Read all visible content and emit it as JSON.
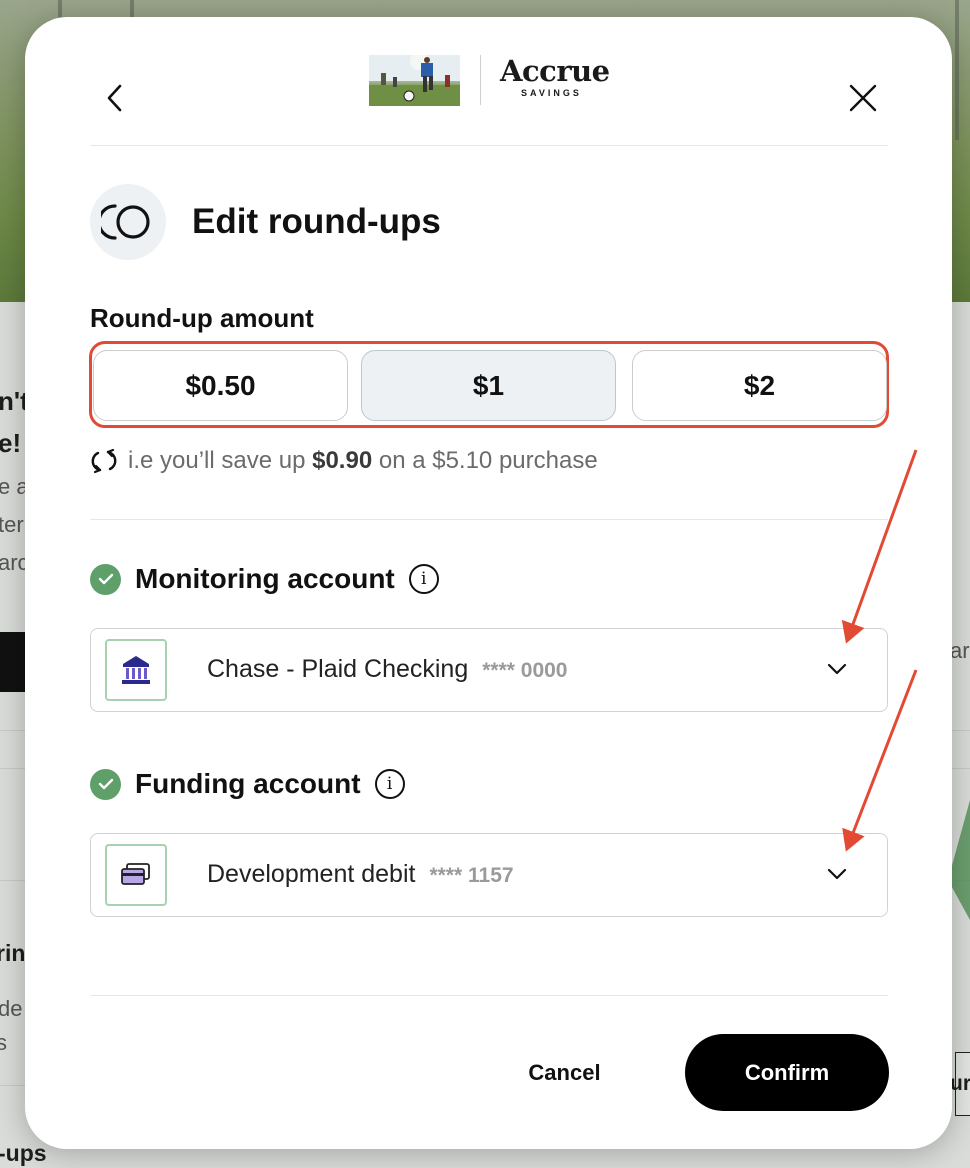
{
  "background": {
    "fragments": [
      "n't",
      "e!",
      "e a",
      "ter",
      "arc",
      "ring",
      "de",
      "s",
      "-ups",
      "ar",
      "ur"
    ]
  },
  "header": {
    "brand_name": "Accrue",
    "brand_sub": "SAVINGS",
    "back_icon": "chevron-left-icon",
    "close_icon": "close-icon"
  },
  "title": {
    "text": "Edit round-ups",
    "icon": "round-up-icon"
  },
  "roundup": {
    "label": "Round-up amount",
    "options": [
      "$0.50",
      "$1",
      "$2"
    ],
    "selected": "$1",
    "hint_prefix": "i.e you’ll save up",
    "hint_amount": "$0.90",
    "hint_suffix": "on a $5.10 purchase"
  },
  "monitoring": {
    "label": "Monitoring account",
    "account_name": "Chase - Plaid Checking",
    "account_mask": "**** 0000",
    "icon": "bank-icon"
  },
  "funding": {
    "label": "Funding account",
    "account_name": "Development debit",
    "account_mask": "**** 1157",
    "icon": "card-icon"
  },
  "actions": {
    "cancel": "Cancel",
    "confirm": "Confirm"
  },
  "colors": {
    "highlight": "#e24a33",
    "check": "#5e9f6a",
    "selected_bg": "#edf1f3",
    "confirm_bg": "#000000"
  }
}
